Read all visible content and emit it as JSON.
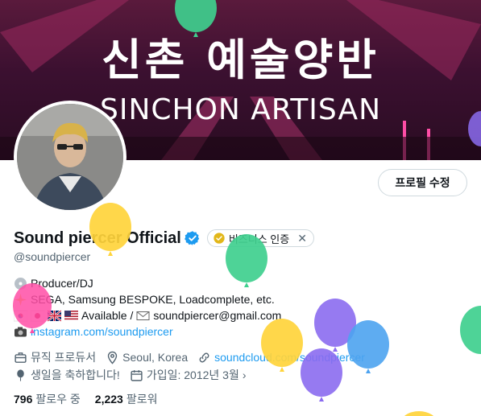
{
  "banner": {
    "title_ko": "신촌 예술양반",
    "title_en": "SINCHON ARTISAN"
  },
  "profile": {
    "edit_button": "프로필 수정",
    "display_name": "Sound piercer Official",
    "business_chip": "비즈니스 인증",
    "handle": "@soundpiercer",
    "bio": {
      "line1": "Producer/DJ",
      "line2": "SEGA, Samsung BESPOKE, Loadcomplete, etc.",
      "line3_available": "Available /",
      "line3_email": "soundpiercer@gmail.com",
      "line4_link": "instagram.com/soundpiercer"
    },
    "meta": {
      "category": "뮤직 프로듀서",
      "location": "Seoul, Korea",
      "website": "soundcloud.com/soundpiercer",
      "birthday": "생일을 축하합니다!",
      "joined": "가입일: 2012년 3월"
    },
    "following_count": "796",
    "following_label": "팔로우 중",
    "followers_count": "2,223",
    "followers_label": "팔로워"
  },
  "colors": {
    "link": "#1d9bf0",
    "verified": "#1d9bf0",
    "gold": "#e2b719",
    "muted": "#536471"
  }
}
